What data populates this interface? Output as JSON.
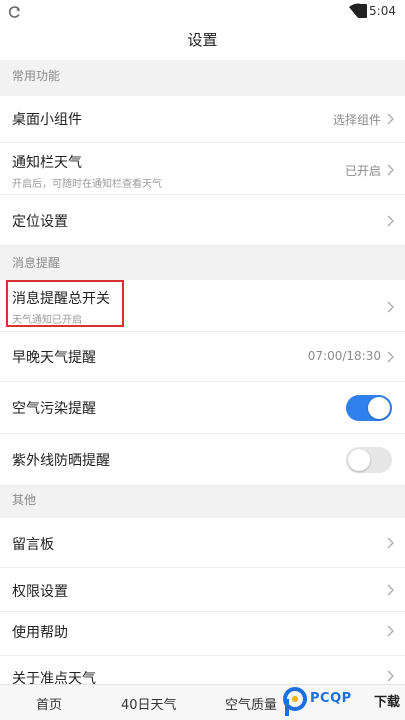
{
  "status_bar": {
    "time": "5:04"
  },
  "nav": {
    "title": "设置"
  },
  "sections": {
    "common": "常用功能",
    "messages": "消息提醒",
    "other": "其他"
  },
  "rows": {
    "widget": {
      "title": "桌面小组件",
      "value": "选择组件"
    },
    "notification_weather": {
      "title": "通知栏天气",
      "sub": "开启后，可随时在通知栏查看天气",
      "value": "已开启"
    },
    "location": {
      "title": "定位设置"
    },
    "master_switch": {
      "title": "消息提醒总开关",
      "sub": "天气通知已开启"
    },
    "morning_evening": {
      "title": "早晚天气提醒",
      "value": "07:00/18:30"
    },
    "air_pollution": {
      "title": "空气污染提醒",
      "enabled": true
    },
    "uv": {
      "title": "紫外线防晒提醒",
      "enabled": false
    },
    "guestbook": {
      "title": "留言板"
    },
    "permissions": {
      "title": "权限设置"
    },
    "help": {
      "title": "使用帮助"
    },
    "about": {
      "title": "关于准点天气"
    }
  },
  "tabs": [
    "首页",
    "40日天气",
    "空气质量"
  ],
  "watermark": {
    "brand": "PCQP",
    "suffix": "下载"
  },
  "colors": {
    "toggle_on": "#2f80ed",
    "toggle_off": "#e6e6e6",
    "highlight": "#d93030"
  },
  "icons": [
    "app-status-icon",
    "wifi-icon",
    "battery-icon",
    "chevron-right-icon",
    "pcqp-logo-icon"
  ]
}
